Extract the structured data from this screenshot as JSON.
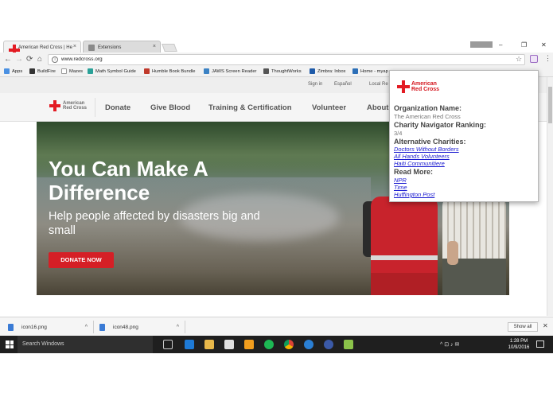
{
  "browser": {
    "tabs": [
      {
        "label": "American Red Cross | He",
        "close": "×"
      },
      {
        "label": "Extensions",
        "close": "×"
      }
    ],
    "user_badge": "",
    "window_controls": {
      "minimize": "–",
      "maximize": "❐",
      "close": "✕"
    },
    "nav": {
      "back": "←",
      "forward": "→",
      "reload": "⟳",
      "home": "⌂"
    },
    "address": "www.redcross.org",
    "star": "☆",
    "menu": "⋮"
  },
  "bookmarks": [
    {
      "label": "Apps",
      "color": "#4a90e2"
    },
    {
      "label": "BuildFire",
      "color": "#333333"
    },
    {
      "label": "Mazes",
      "color": "#9a9a9a"
    },
    {
      "label": "Math Symbol Guide",
      "color": "#2aa198"
    },
    {
      "label": "Humble Book Bundle",
      "color": "#c0392b"
    },
    {
      "label": "JAWS Screen Reader",
      "color": "#3b82c4"
    },
    {
      "label": "ThoughtWorks",
      "color": "#555555"
    },
    {
      "label": "Zimbra: Inbox",
      "color": "#1e5aa8"
    },
    {
      "label": "Home - myap",
      "color": "#2c6fb7"
    }
  ],
  "site": {
    "utility": {
      "sign_in": "Sign in",
      "espanol": "Español",
      "local": "Local Re"
    },
    "logo_text": "American Red Cross",
    "nav": [
      "Donate",
      "Give Blood",
      "Training & Certification",
      "Volunteer",
      "About"
    ],
    "hero": {
      "title": "You Can Make A Difference",
      "subtitle": "Help people affected by disasters big and small",
      "cta": "DONATE NOW"
    }
  },
  "popup": {
    "logo_text": "American Red Cross",
    "org_label": "Organization Name:",
    "org_value": "The American Red Cross",
    "rank_label": "Charity Navigator Ranking:",
    "rank_value": "3/4",
    "alt_label": "Alternative Charities:",
    "alternatives": [
      "Doctors Without Borders",
      "All Hands Volunteers",
      "Haiti Communitiere"
    ],
    "read_label": "Read More:",
    "read_more": [
      "NPR",
      "Time",
      "Huffington Post"
    ]
  },
  "downloads": {
    "files": [
      "icon16.png",
      "icon48.png"
    ],
    "show_all": "Show all",
    "close": "✕"
  },
  "taskbar": {
    "search": "Search Windows",
    "time": "1:28 PM",
    "date": "10/9/2016",
    "tray": "^  ⊡  ♪  ✉"
  }
}
